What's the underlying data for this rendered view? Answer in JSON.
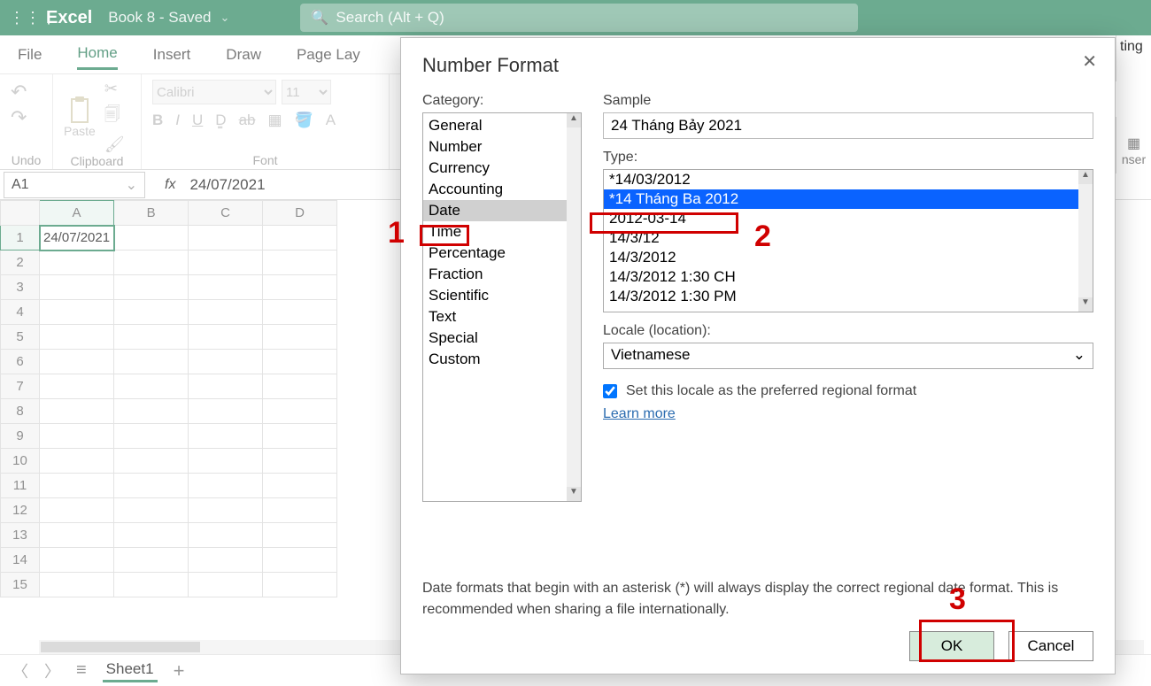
{
  "app": {
    "name": "Excel",
    "doc": "Book 8 - Saved"
  },
  "search": {
    "placeholder": "Search (Alt + Q)"
  },
  "tabs": [
    "File",
    "Home",
    "Insert",
    "Draw",
    "Page Lay"
  ],
  "tabs_active": 1,
  "ribbon": {
    "undo": "Undo",
    "clipboard": "Clipboard",
    "paste": "Paste",
    "font_group": "Font",
    "font_name": "Calibri",
    "font_size": "11"
  },
  "tingpanel": "ting",
  "nserpanel": "nser",
  "namebox": "A1",
  "formula": "24/07/2021",
  "columns": [
    "A",
    "B",
    "C",
    "D"
  ],
  "cell_a1": "24/07/2021",
  "sheet": "Sheet1",
  "dialog": {
    "title": "Number Format",
    "cat_label": "Category:",
    "categories": [
      "General",
      "Number",
      "Currency",
      "Accounting",
      "Date",
      "Time",
      "Percentage",
      "Fraction",
      "Scientific",
      "Text",
      "Special",
      "Custom"
    ],
    "cat_selected": 4,
    "sample_label": "Sample",
    "sample": "24 Tháng Bảy 2021",
    "type_label": "Type:",
    "types": [
      "*14/03/2012",
      "*14 Tháng Ba 2012",
      "2012-03-14",
      "14/3/12",
      "14/3/2012",
      "14/3/2012 1:30 CH",
      "14/3/2012 1:30 PM"
    ],
    "type_selected": 1,
    "locale_label": "Locale (location):",
    "locale": "Vietnamese",
    "chk_label": "Set this locale as the preferred regional format",
    "learn": "Learn more",
    "desc": "Date formats that begin with an asterisk (*) will always display the correct regional date format. This is recommended when sharing a file internationally.",
    "ok": "OK",
    "cancel": "Cancel"
  },
  "annot": {
    "n1": "1",
    "n2": "2",
    "n3": "3"
  }
}
